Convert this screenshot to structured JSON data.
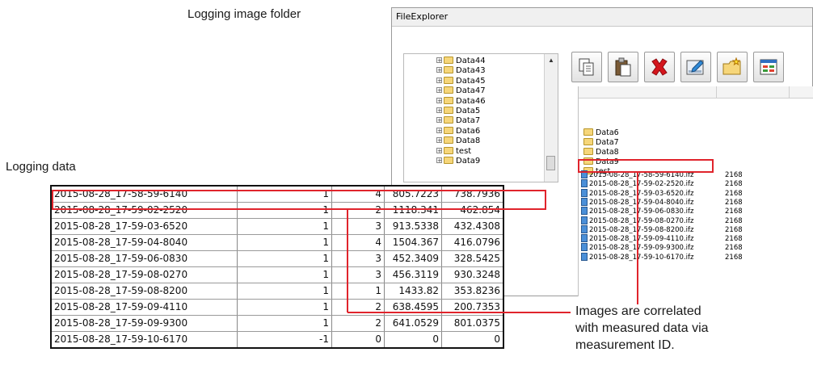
{
  "labels": {
    "logging_image_folder": "Logging image folder",
    "logging_data": "Logging data",
    "note_line1": "Images are correlated",
    "note_line2": "with measured data via",
    "note_line3": "measurement ID."
  },
  "window": {
    "title": "FileExplorer"
  },
  "tree": {
    "items": [
      "Data44",
      "Data43",
      "Data45",
      "Data47",
      "Data46",
      "Data5",
      "Data7",
      "Data6",
      "Data8",
      "test",
      "Data9"
    ]
  },
  "toolbar": {
    "icons": [
      "copy-icon",
      "paste-icon",
      "delete-icon",
      "edit-icon",
      "new-folder-icon",
      "view-icon"
    ]
  },
  "filelist": {
    "folders": [
      "Data6",
      "Data7",
      "Data8",
      "Data9",
      "test"
    ],
    "files": [
      {
        "name": "2015-08-28_17-58-59-6140.ifz",
        "size": "2168"
      },
      {
        "name": "2015-08-28_17-59-02-2520.ifz",
        "size": "2168"
      },
      {
        "name": "2015-08-28_17-59-03-6520.ifz",
        "size": "2168"
      },
      {
        "name": "2015-08-28_17-59-04-8040.ifz",
        "size": "2168"
      },
      {
        "name": "2015-08-28_17-59-06-0830.ifz",
        "size": "2168"
      },
      {
        "name": "2015-08-28_17-59-08-0270.ifz",
        "size": "2168"
      },
      {
        "name": "2015-08-28_17-59-08-8200.ifz",
        "size": "2168"
      },
      {
        "name": "2015-08-28_17-59-09-4110.ifz",
        "size": "2168"
      },
      {
        "name": "2015-08-28_17-59-09-9300.ifz",
        "size": "2168"
      },
      {
        "name": "2015-08-28_17-59-10-6170.ifz",
        "size": "2168"
      }
    ]
  },
  "table": {
    "rows": [
      [
        "2015-08-28_17-58-59-6140",
        "1",
        "4",
        "805.7223",
        "738.7936"
      ],
      [
        "2015-08-28_17-59-02-2520",
        "1",
        "2",
        "1118.341",
        "462.854"
      ],
      [
        "2015-08-28_17-59-03-6520",
        "1",
        "3",
        "913.5338",
        "432.4308"
      ],
      [
        "2015-08-28_17-59-04-8040",
        "1",
        "4",
        "1504.367",
        "416.0796"
      ],
      [
        "2015-08-28_17-59-06-0830",
        "1",
        "3",
        "452.3409",
        "328.5425"
      ],
      [
        "2015-08-28_17-59-08-0270",
        "1",
        "3",
        "456.3119",
        "930.3248"
      ],
      [
        "2015-08-28_17-59-08-8200",
        "1",
        "1",
        "1433.82",
        "353.8236"
      ],
      [
        "2015-08-28_17-59-09-4110",
        "1",
        "2",
        "638.4595",
        "200.7353"
      ],
      [
        "2015-08-28_17-59-09-9300",
        "1",
        "2",
        "641.0529",
        "801.0375"
      ],
      [
        "2015-08-28_17-59-10-6170",
        "-1",
        "0",
        "0",
        "0"
      ]
    ]
  },
  "colors": {
    "highlight": "#e0242c",
    "table_border": "#111111"
  }
}
